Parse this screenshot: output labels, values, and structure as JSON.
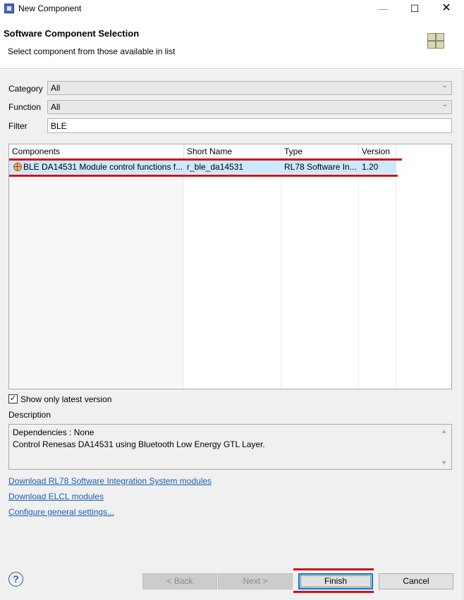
{
  "window": {
    "title": "New Component",
    "minimize_glyph": "—",
    "maximize_glyph": "☐",
    "close_glyph": "✕"
  },
  "header": {
    "title": "Software Component Selection",
    "subtitle": "Select component from those available in list"
  },
  "form": {
    "category_label": "Category",
    "category_value": "All",
    "function_label": "Function",
    "function_value": "All",
    "filter_label": "Filter",
    "filter_value": "BLE"
  },
  "table": {
    "columns": [
      "Components",
      "Short Name",
      "Type",
      "Version"
    ],
    "rows": [
      {
        "component": "BLE DA14531 Module control functions f...",
        "short_name": "r_ble_da14531",
        "type": "RL78 Software In...",
        "version": "1.20"
      }
    ]
  },
  "options": {
    "show_latest_label": "Show only latest version",
    "show_latest_checked": true
  },
  "description": {
    "label": "Description",
    "lines": [
      "Dependencies : None",
      "Control Renesas DA14531 using Bluetooth Low Energy GTL Layer."
    ]
  },
  "links": [
    "Download RL78 Software Integration System modules",
    "Download ELCL modules",
    "Configure general settings..."
  ],
  "buttons": {
    "back": "< Back",
    "next": "Next >",
    "finish": "Finish",
    "cancel": "Cancel"
  },
  "colors": {
    "selection": "#cce8ff",
    "highlight_red": "#d0101a",
    "link": "#1a5fb4"
  }
}
